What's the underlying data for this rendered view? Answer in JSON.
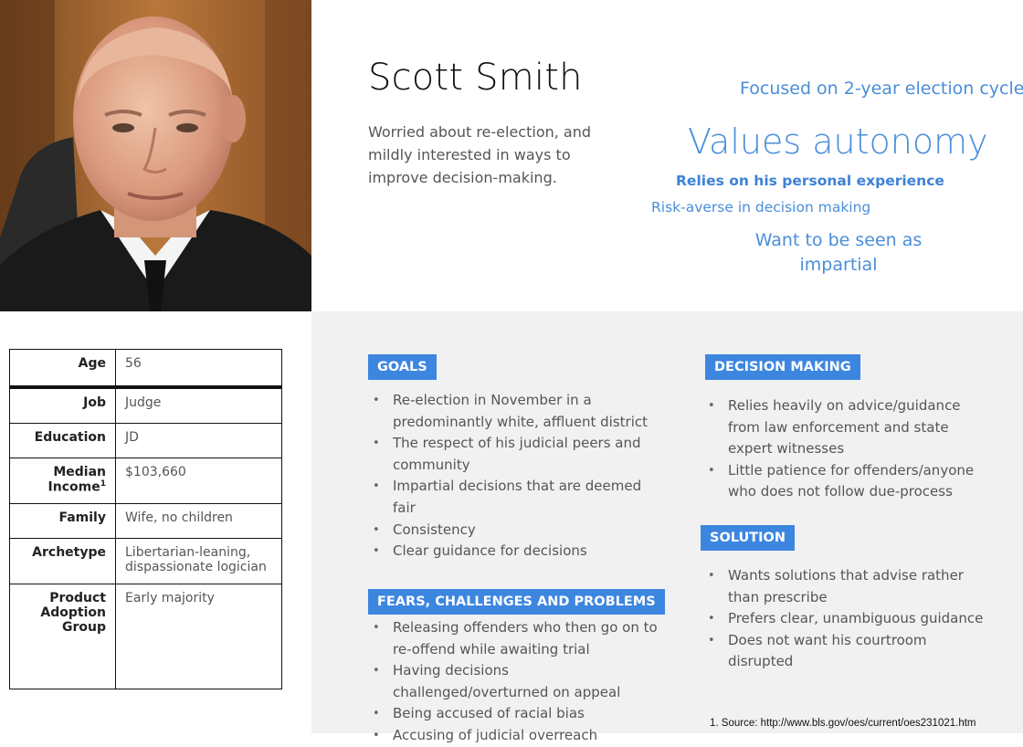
{
  "persona": {
    "name": "Scott Smith",
    "summary": "Worried about re-election, and mildly interested in ways to improve decision-making."
  },
  "word_cloud": [
    "Focused on 2-year election cycle",
    "Values autonomy",
    "Relies on his personal experience",
    "Risk-averse in decision making",
    "Want to be seen as impartial"
  ],
  "facts": [
    {
      "label": "Age",
      "value": "56"
    },
    {
      "label": "Job",
      "value": "Judge"
    },
    {
      "label": "Education",
      "value": "JD"
    },
    {
      "label": "Median Income",
      "sup": "1",
      "value": "$103,660"
    },
    {
      "label": "Family",
      "value": "Wife, no children"
    },
    {
      "label": "Archetype",
      "value": "Libertarian-leaning, dispassionate logician"
    },
    {
      "label": "Product Adoption Group",
      "value": "Early majority"
    }
  ],
  "goals": {
    "title": "GOALS",
    "items": [
      "Re-election in November in a predominantly white, affluent district",
      "The respect of his judicial peers and community",
      "Impartial decisions that are deemed fair",
      "Consistency",
      "Clear guidance for decisions"
    ]
  },
  "fears": {
    "title": "FEARS, CHALLENGES AND PROBLEMS",
    "items": [
      "Releasing offenders who then go on to re-offend while awaiting trial",
      "Having decisions challenged/overturned on appeal",
      "Being accused of racial bias",
      "Accusing of judicial overreach"
    ]
  },
  "decision_making": {
    "title": "DECISION MAKING",
    "items": [
      "Relies heavily on advice/guidance from law enforcement and state expert witnesses",
      "Little patience for offenders/anyone who does not follow due-process"
    ]
  },
  "solution": {
    "title": "SOLUTION",
    "items": [
      "Wants solutions that advise rather than prescribe",
      "Prefers clear, unambiguous guidance",
      "Does not want his courtroom disrupted"
    ]
  },
  "footnote": "1. Source: http://www.bls.gov/oes/current/oes231021.htm",
  "colors": {
    "accent": "#3d86e0",
    "cloud": "#4a8ed9",
    "panel": "#f1f1f1"
  }
}
